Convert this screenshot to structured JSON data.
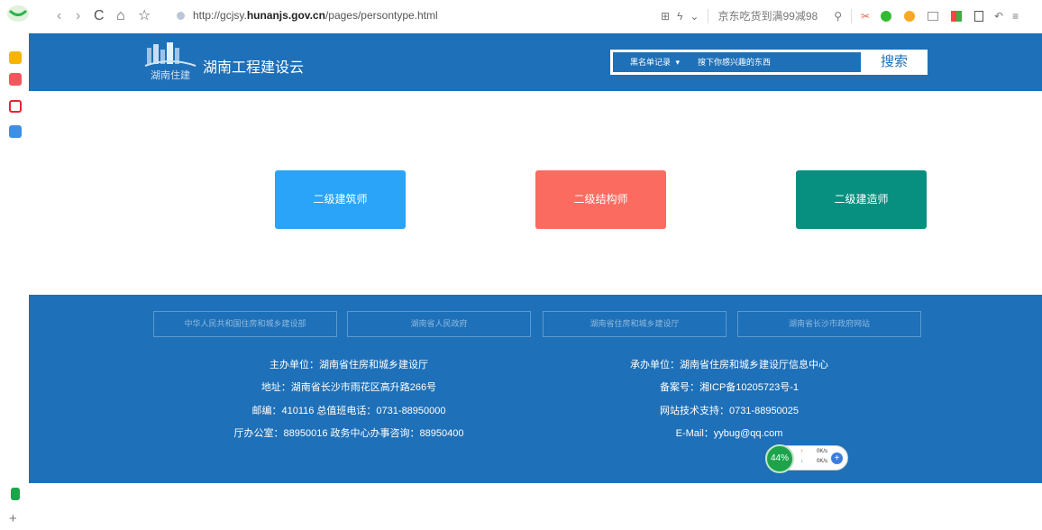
{
  "browser": {
    "url_prefix": "http://gcjsy.",
    "url_domain": "hunanjs.gov.cn",
    "url_path": "/pages/persontype.html",
    "promo_text": "京东吃货到满99减98",
    "nav": {
      "back": "‹",
      "forward": "›",
      "reload": "C",
      "home": "⌂",
      "star": "☆"
    },
    "grid_icon": "⊞",
    "bolt_icon": "ϟ",
    "chevron": "⌄",
    "search_icon": "⚲",
    "menu_icon": "≡",
    "plus_icon": "+"
  },
  "header": {
    "site_title": "湖南工程建设云",
    "search_category": "黑名单记录",
    "search_placeholder": "搜下你感兴趣的东西",
    "search_button": "搜索",
    "logo_text": "湖南住建"
  },
  "cards": {
    "architect": "二级建筑师",
    "structural": "二级结构师",
    "constructor": "二级建造师"
  },
  "footer": {
    "links": [
      "中华人民共和国住房和城乡建设部",
      "湖南省人民政府",
      "湖南省住房和城乡建设厅",
      "湖南省长沙市政府网站"
    ],
    "left": [
      "主办单位：湖南省住房和城乡建设厅",
      "地址：湖南省长沙市雨花区高升路266号",
      "邮编：410116 总值班电话：0731-88950000",
      "厅办公室：88950016 政务中心办事咨询：88950400"
    ],
    "right": [
      "承办单位：湖南省住房和城乡建设厅信息中心",
      "备案号：湘ICP备10205723号-1",
      "网站技术支持：0731-88950025",
      "E-Mail：yybug@qq.com"
    ]
  },
  "speed_widget": {
    "percent": "44%",
    "up": "0K/s",
    "down": "0K/s",
    "up_arrow": "↑",
    "down_arrow": "↓",
    "plus": "+"
  },
  "colors": {
    "primary": "#1e70b8",
    "architect": "#2aa4f8",
    "structural": "#fb6b60",
    "constructor": "#079080"
  }
}
